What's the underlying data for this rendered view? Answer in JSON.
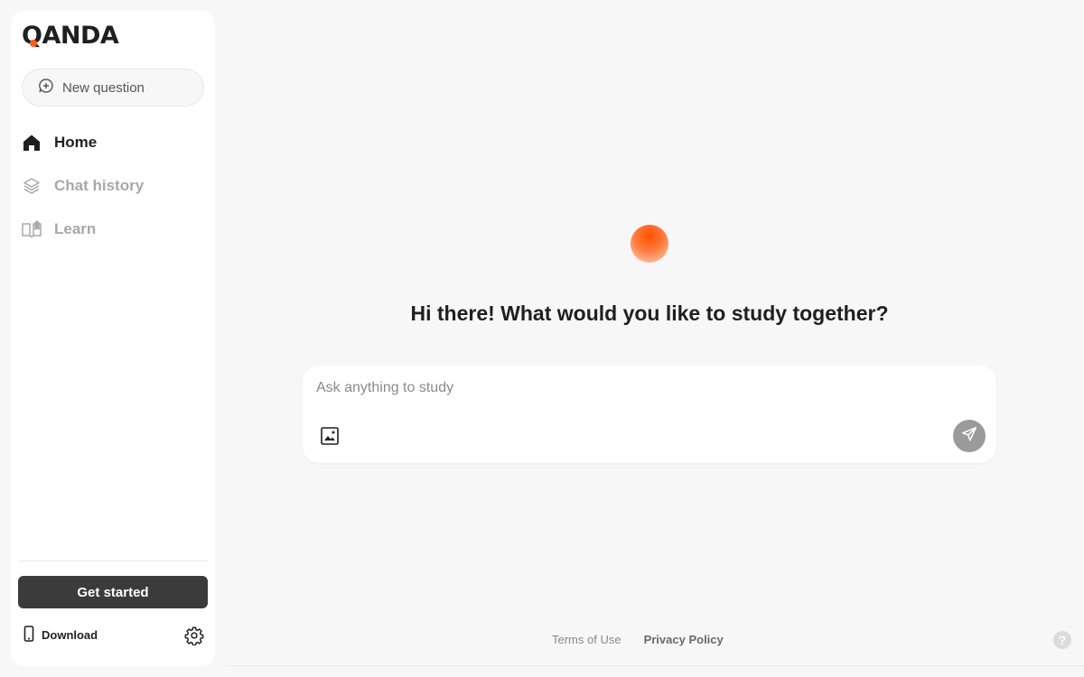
{
  "brand": {
    "logo_text": "QANDA",
    "accent_color": "#ff5a1f"
  },
  "sidebar": {
    "new_question_label": "New question",
    "items": [
      {
        "label": "Home",
        "icon": "home-icon",
        "active": true
      },
      {
        "label": "Chat history",
        "icon": "layers-icon",
        "active": false
      },
      {
        "label": "Learn",
        "icon": "book-icon",
        "active": false
      }
    ],
    "get_started_label": "Get started",
    "download_label": "Download"
  },
  "main": {
    "headline": "Hi there! What would you like to study together?",
    "input_placeholder": "Ask anything to study"
  },
  "footer": {
    "terms_label": "Terms of Use",
    "privacy_label": "Privacy Policy",
    "help_label": "?"
  }
}
